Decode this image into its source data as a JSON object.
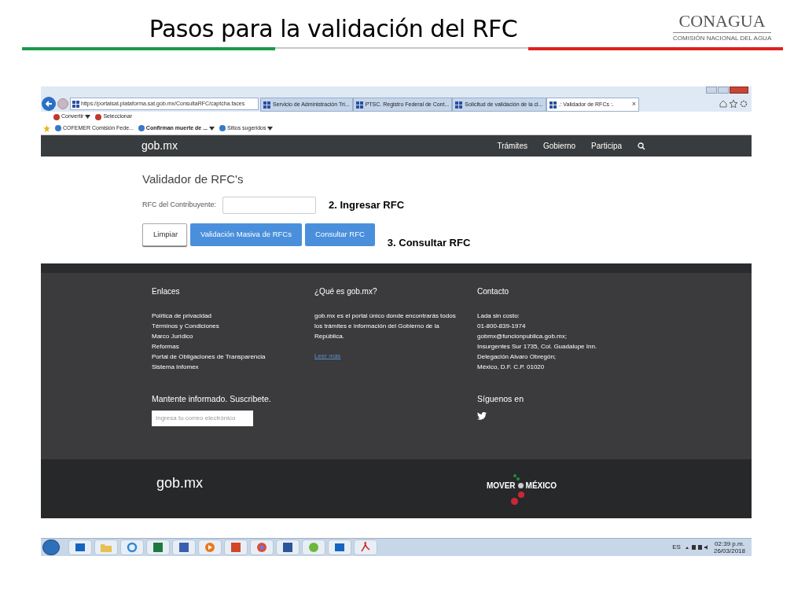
{
  "slide": {
    "title": "Pasos para la validación del RFC",
    "logo": {
      "name": "CONAGUA",
      "subtitle": "COMISIÓN NACIONAL DEL AGUA"
    }
  },
  "browser": {
    "address": "https://portalsat.plataforma.sat.gob.mx/ConsultaRFC/captcha.faces",
    "tabs": [
      {
        "label": "Servicio de Administración Tri...",
        "selected": false
      },
      {
        "label": "PTSC. Registro Federal de Cont...",
        "selected": false
      },
      {
        "label": "Solicitud de validación de la cl...",
        "selected": false
      },
      {
        "label": ".: Validador de RFCs :.",
        "selected": true
      }
    ],
    "tab_close": "×",
    "toolbar": [
      {
        "label": "Convertir",
        "dropdown": true
      },
      {
        "label": "Seleccionar",
        "dropdown": false
      }
    ],
    "favorites": [
      {
        "label": "COFEMER  Comisión Fede...",
        "bold": false,
        "dropdown": false
      },
      {
        "label": "Confirman muerte de ...",
        "bold": true,
        "dropdown": true
      },
      {
        "label": "Sitios sugeridos",
        "bold": false,
        "dropdown": true
      }
    ]
  },
  "nav": {
    "brand": "gob.mx",
    "links": [
      "Trámites",
      "Gobierno",
      "Participa"
    ]
  },
  "form": {
    "heading": "Validador de RFC's",
    "field_label": "RFC del Contribuyente:",
    "buttons": [
      {
        "label": "Limpiar",
        "kind": "default"
      },
      {
        "label": "Validación Masiva de RFCs",
        "kind": "primary"
      },
      {
        "label": "Consultar RFC",
        "kind": "primary"
      }
    ],
    "annotations": [
      "2. Ingresar RFC",
      "3. Consultar RFC"
    ]
  },
  "footer": {
    "enlaces": {
      "title": "Enlaces",
      "links": [
        "Política de privacidad",
        "Términos y Condiciones",
        "Marco Jurídico",
        "Reformas",
        "Portal de Obligaciones de Transparencia",
        "Sistema Infomex"
      ]
    },
    "about": {
      "title": "¿Qué es gob.mx?",
      "text": "gob.mx es el portal único donde encontrarás todos los trámites e información del Gobierno de la República.",
      "link": "Leer más"
    },
    "contact": {
      "title": "Contacto",
      "lines": [
        "Lada sin costo:",
        "01-800-839-1974",
        "gobmx@funcionpublica.gob.mx;",
        "Insurgentes Sur 1735, Col. Guadalupe Inn.",
        "Delegación Alvaro Obregón;",
        "México, D.F. C.P. 01020"
      ]
    },
    "subscribe": {
      "title": "Mantente informado. Suscribete.",
      "placeholder": "Ingresa tu correo electrónico"
    },
    "social": {
      "title": "Síguenos en"
    },
    "bottom": {
      "brand": "gob.mx",
      "campaign_left": "MOVER",
      "campaign_right": "MÉXICO"
    }
  },
  "taskbar": {
    "language": "ES",
    "time": "02:39 p.m.",
    "date": "26/03/2018"
  }
}
